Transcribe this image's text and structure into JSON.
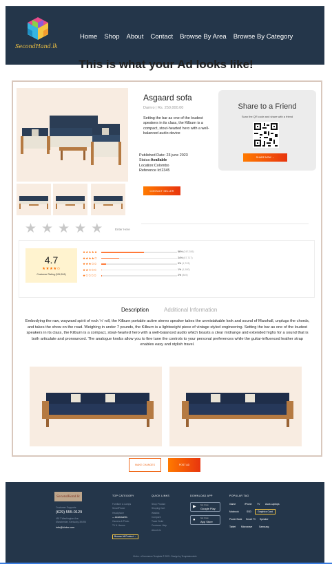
{
  "header": {
    "logo_text": "SecondHand.lk",
    "nav": [
      "Home",
      "Shop",
      "About",
      "Contact",
      "Browse By Area",
      "Browse By Category"
    ]
  },
  "page_title": "This is what your Ad looks like!",
  "product": {
    "title": "Asgaard sofa",
    "price": "Damro | Rs. 250,000.00",
    "description": "Setting the bar as one of the loudest speakers in its class, the Kilburn is a compact, stout-hearted hero with a well-balanced audio device",
    "published": "Published Date: 23 june 2023",
    "status_label": "Status:",
    "status_value": "Available",
    "location": "Location:Colombo",
    "reference": "Reference Id:2345",
    "contact_label": "CONTACT SELLER"
  },
  "share": {
    "title": "Share to a Friend",
    "subtitle": "Scan the QR code and share with a friend",
    "button": "SHARE NOW →"
  },
  "review": {
    "star_icons": "★★★★★",
    "enter_here": "Enter Here"
  },
  "rating": {
    "value": "4.7",
    "stars": "★★★★✩",
    "label": "Customer Rating (934,516)",
    "distribution": [
      {
        "stars": "★★★★★",
        "fraction": 0.56,
        "pct": "56%",
        "count": "(247,026)"
      },
      {
        "stars": "★★★★✩",
        "fraction": 0.24,
        "pct": "24%",
        "count": "(67,717)"
      },
      {
        "stars": "★★★✩✩",
        "fraction": 0.06,
        "pct": "9%",
        "count": "(1,743)"
      },
      {
        "stars": "★★✩✩✩",
        "fraction": 0.01,
        "pct": "1%",
        "count": "(1,180)"
      },
      {
        "stars": "★✩✩✩✩",
        "fraction": 0.01,
        "pct": "2%",
        "count": "(849)"
      }
    ]
  },
  "tabs": {
    "description": "Description",
    "additional": "Additional Information"
  },
  "description_text": "Embodying the raw, wayward spirit of rock 'n' roll, the Kilburn portable active stereo speaker takes the unmistakable look and sound of Marshall, unplugs the chords, and takes the show on the road. Weighing in under 7 pounds, the Kilburn is a lightweight piece of vintage styled engineering. Setting the bar as one of the loudest speakers in its class, the Kilburn is a compact, stout-hearted hero with a well-balanced audio which boasts a clear midrange and extended highs for a sound that is both articulate and pronounced. The analogue knobs allow you to fine tune the controls to your personal preferences while the guitar-influenced leather strap enables easy and stylish travel.",
  "actions": {
    "make_changes": "MAKE CHANGES",
    "post_ad": "POST AD"
  },
  "footer": {
    "logo_text": "SecondHand.lk",
    "support_label": "Customer Supports:",
    "phone": "(629) 555-0129",
    "address_line1": "4517 Washington Ave.",
    "address_line2": "Manchester, Kentucky 39495",
    "email": "info@kinbo.com",
    "top_category": {
      "heading": "TOP CATEGORY",
      "items": [
        "Furniture & Lamps",
        "SmartPhone",
        "Headphone",
        "— Accessories",
        "Camera & Photo",
        "TV & Homes",
        "Browse All Product →"
      ]
    },
    "quick_links": {
      "heading": "QUICK LINKS",
      "items": [
        "Shop Product",
        "Shoping Cart",
        "Wishlist",
        "Compare",
        "Track Order",
        "Customer Help",
        "About Us"
      ]
    },
    "download": {
      "heading": "DOWNLOAD APP",
      "google_small": "Get it now",
      "google_large": "Google Play",
      "apple_small": "Get it now",
      "apple_large": "App Store"
    },
    "popular_tag": {
      "heading": "POPULAR TAG",
      "tags": [
        "Game",
        "iPhone",
        "TV",
        "Asus Laptops",
        "Macbook",
        "SSD",
        "Graphics Card",
        "Power Bank",
        "Smart TV",
        "Speaker",
        "Tablet",
        "Microwave",
        "Samsung"
      ]
    },
    "copyright": "Kinbo - eCommerce Template © 2021. Design by Templatecookie"
  },
  "colors": {
    "header_bg": "#24364a",
    "accent": "#ff6a00",
    "card_border": "#d9c8bd",
    "image_bg": "#f8ece1"
  }
}
